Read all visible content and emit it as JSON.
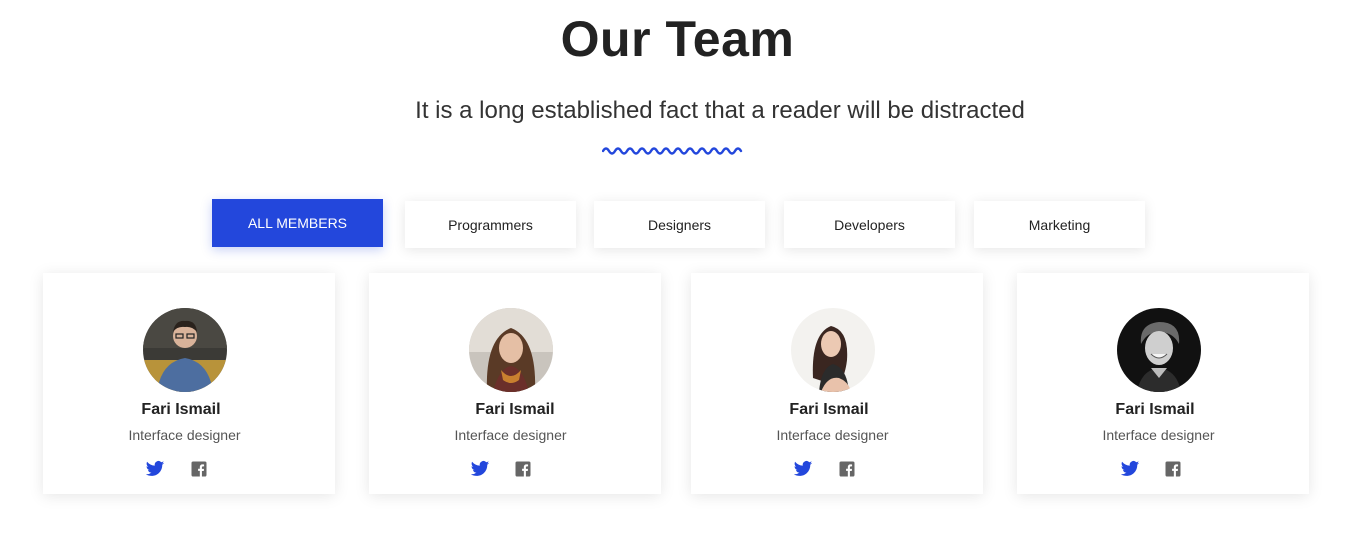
{
  "header": {
    "title": "Our Team",
    "subtitle": "It is a long established fact that a reader will be distracted"
  },
  "colors": {
    "accent": "#2347dc",
    "twitter": "#2347dc",
    "facebook": "#666666"
  },
  "filters": [
    {
      "label": "ALL MEMBERS",
      "active": true
    },
    {
      "label": "Programmers",
      "active": false
    },
    {
      "label": "Designers",
      "active": false
    },
    {
      "label": "Developers",
      "active": false
    },
    {
      "label": "Marketing",
      "active": false
    }
  ],
  "members": [
    {
      "name": "Fari Ismail",
      "role": "Interface designer",
      "icons": [
        "twitter-icon",
        "facebook-icon"
      ]
    },
    {
      "name": "Fari Ismail",
      "role": "Interface designer",
      "icons": [
        "twitter-icon",
        "facebook-icon"
      ]
    },
    {
      "name": "Fari Ismail",
      "role": "Interface designer",
      "icons": [
        "twitter-icon",
        "facebook-icon"
      ]
    },
    {
      "name": "Fari Ismail",
      "role": "Interface designer",
      "icons": [
        "twitter-icon",
        "facebook-icon"
      ]
    }
  ]
}
